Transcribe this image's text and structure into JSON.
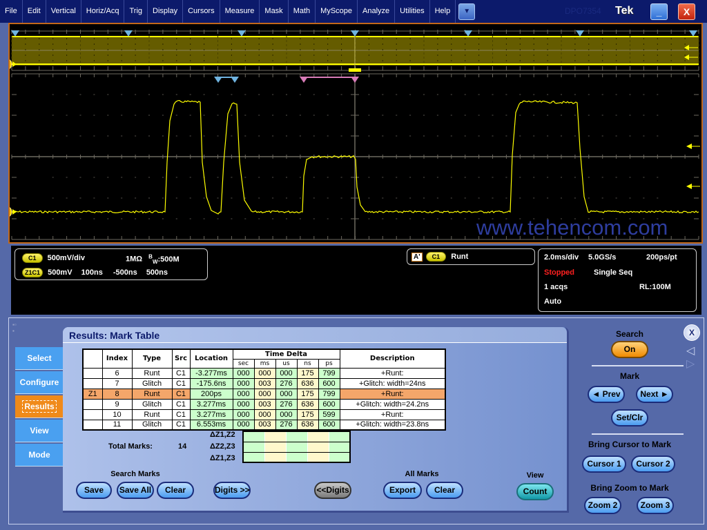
{
  "menubar": {
    "items": [
      "File",
      "Edit",
      "Vertical",
      "Horiz/Acq",
      "Trig",
      "Display",
      "Cursors",
      "Measure",
      "Mask",
      "Math",
      "MyScope",
      "Analyze",
      "Utilities",
      "Help"
    ],
    "dropdown_icon": "triangle-down",
    "model": "DPO7354",
    "brand": "Tek",
    "minimize_label": "_",
    "close_label": "X"
  },
  "scope": {
    "channel_marker": "1",
    "watermark": "www.tehencom.com",
    "trace_color": "#ffff00",
    "graticule_color": "#6e6a60",
    "search_mark_color": "#6fb3e0",
    "zoom_mark_color": "#d87cb8"
  },
  "readouts": {
    "ch1_badge": "C1",
    "ch1_scale": "500mV/div",
    "ch1_impedance": "1MΩ",
    "ch1_bw_prefix": "B",
    "ch1_bw_sub": "W",
    "ch1_bw": ":500M",
    "zoom_badge": "Z1C1",
    "zoom_vscale": "500mV",
    "zoom_hscale": "100ns",
    "zoom_pos1": "-500ns",
    "zoom_pos2": "500ns",
    "search_badge": "A'",
    "search_channel": "C1",
    "search_type": "Runt",
    "horiz_scale": "2.0ms/div",
    "sample_rate": "5.0GS/s",
    "resolution": "200ps/pt",
    "acq_state": "Stopped",
    "acq_mode": "Single Seq",
    "acq_count": "1 acqs",
    "record_length": "RL:100M",
    "trigger_mode": "Auto"
  },
  "panel": {
    "side_tabs": [
      "Select",
      "Configure",
      "Results",
      "View",
      "Mode"
    ],
    "active_tab": "Results",
    "title": "Results: Mark Table",
    "table": {
      "headers": {
        "zoom": "",
        "index": "Index",
        "type": "Type",
        "src": "Src",
        "location": "Location",
        "time_delta": "Time Delta",
        "description": "Description"
      },
      "sub_headers": [
        "sec",
        "ms",
        "us",
        "ns",
        "ps"
      ],
      "rows": [
        {
          "zoom": "",
          "index": "6",
          "type": "Runt",
          "src": "C1",
          "location": "-3.277ms",
          "sec": "000",
          "ms": "000",
          "us": "000",
          "ns": "175",
          "ps": "799",
          "description": "+Runt:"
        },
        {
          "zoom": "",
          "index": "7",
          "type": "Glitch",
          "src": "C1",
          "location": "-175.6ns",
          "sec": "000",
          "ms": "003",
          "us": "276",
          "ns": "636",
          "ps": "600",
          "description": "+Glitch: width=24ns"
        },
        {
          "zoom": "Z1",
          "index": "8",
          "type": "Runt",
          "src": "C1",
          "location": "200ps",
          "sec": "000",
          "ms": "000",
          "us": "000",
          "ns": "175",
          "ps": "799",
          "description": "+Runt:"
        },
        {
          "zoom": "",
          "index": "9",
          "type": "Glitch",
          "src": "C1",
          "location": "3.277ms",
          "sec": "000",
          "ms": "003",
          "us": "276",
          "ns": "636",
          "ps": "600",
          "description": "+Glitch: width=24.2ns"
        },
        {
          "zoom": "",
          "index": "10",
          "type": "Runt",
          "src": "C1",
          "location": "3.277ms",
          "sec": "000",
          "ms": "000",
          "us": "000",
          "ns": "175",
          "ps": "599",
          "description": "+Runt:"
        },
        {
          "zoom": "",
          "index": "11",
          "type": "Glitch",
          "src": "C1",
          "location": "6.553ms",
          "sec": "000",
          "ms": "003",
          "us": "276",
          "ns": "636",
          "ps": "600",
          "description": "+Glitch: width=23.8ns"
        }
      ],
      "selected_row": 2
    },
    "total_marks_label": "Total Marks:",
    "total_marks": "14",
    "delta_labels": [
      "ΔZ1,Z2",
      "ΔZ2,Z3",
      "ΔZ1,Z3"
    ],
    "search_marks_label": "Search Marks",
    "buttons": {
      "save": "Save",
      "save_all": "Save All",
      "clear_search": "Clear",
      "digits_more": "Digits >>",
      "digits_less": "<<Digits",
      "export": "Export",
      "clear_all": "Clear",
      "count": "Count"
    },
    "all_marks_label": "All Marks",
    "view_label": "View"
  },
  "right_panel": {
    "close_label": "X",
    "search_label": "Search",
    "search_toggle": "On",
    "mark_label": "Mark",
    "prev": "◄ Prev",
    "next": "Next ►",
    "set_clr": "Set/Clr",
    "cursor_label": "Bring Cursor to Mark",
    "cursor1": "Cursor 1",
    "cursor2": "Cursor 2",
    "zoom_label": "Bring Zoom to Mark",
    "zoom2": "Zoom 2",
    "zoom3": "Zoom 3"
  }
}
